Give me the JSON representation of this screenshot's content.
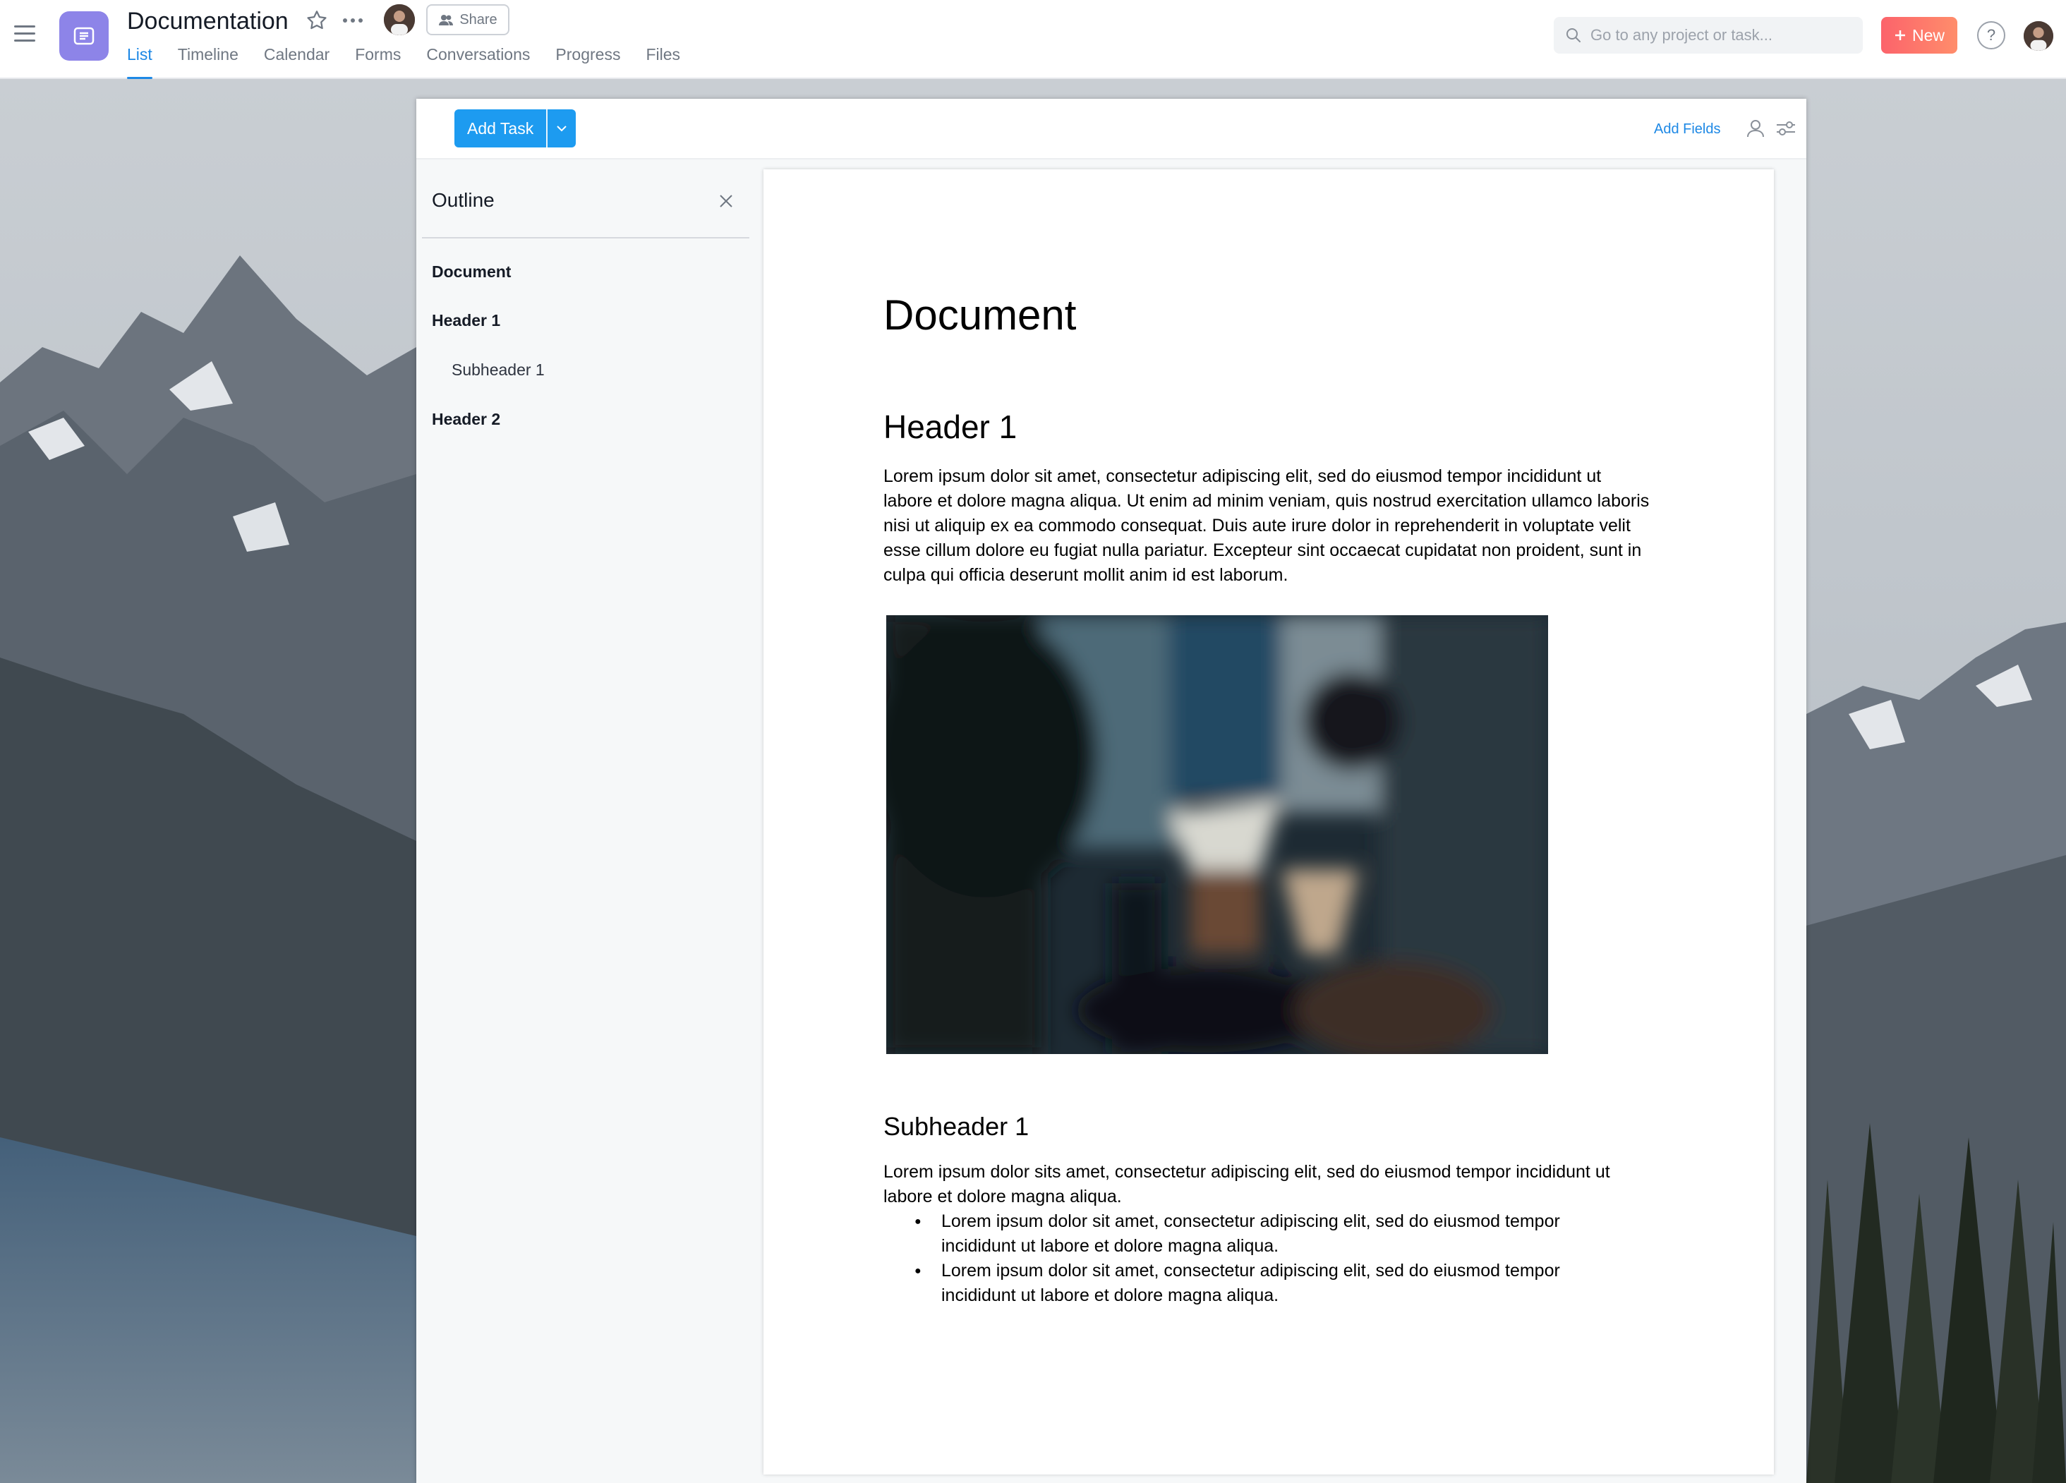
{
  "project": {
    "title": "Documentation",
    "icon": "list-icon",
    "accent": "#8d84e8"
  },
  "header": {
    "share_label": "Share",
    "tabs": [
      {
        "label": "List",
        "active": true
      },
      {
        "label": "Timeline",
        "active": false
      },
      {
        "label": "Calendar",
        "active": false
      },
      {
        "label": "Forms",
        "active": false
      },
      {
        "label": "Conversations",
        "active": false
      },
      {
        "label": "Progress",
        "active": false
      },
      {
        "label": "Files",
        "active": false
      }
    ],
    "search_placeholder": "Go to any project or task...",
    "new_label": "New",
    "help_label": "?"
  },
  "toolbar": {
    "add_task_label": "Add Task",
    "add_fields_label": "Add Fields"
  },
  "outline": {
    "title": "Outline",
    "items": [
      {
        "label": "Document"
      },
      {
        "label": "Header 1"
      },
      {
        "label": "Subheader 1"
      },
      {
        "label": "Header 2"
      }
    ]
  },
  "document": {
    "title": "Document",
    "header1": "Header 1",
    "paragraph1": "Lorem ipsum dolor sit amet, consectetur adipiscing elit, sed do eiusmod tempor incididunt ut labore et dolore magna aliqua. Ut enim ad minim veniam, quis nostrud exercitation ullamco laboris nisi ut aliquip ex ea commodo consequat. Duis aute irure dolor in reprehenderit in voluptate velit esse cillum dolore eu fugiat nulla pariatur. Excepteur sint occaecat cupidatat non proident, sunt in culpa qui officia deserunt mollit anim id est laborum.",
    "subheader1": "Subheader 1",
    "paragraph2": "Lorem ipsum dolor sits amet, consectetur adipiscing elit, sed do eiusmod tempor incididunt ut labore et dolore magna aliqua.",
    "bullets": [
      "Lorem ipsum dolor sit amet, consectetur adipiscing elit, sed do eiusmod tempor incididunt ut labore et dolore magna aliqua.",
      "Lorem ipsum dolor sit amet, consectetur adipiscing elit, sed do eiusmod tempor incididunt ut labore et dolore magna aliqua."
    ]
  },
  "colors": {
    "primary_blue": "#1d9bf0",
    "tab_active": "#1d88e5",
    "new_gradient_start": "#fc636b",
    "new_gradient_end": "#ff8d6b"
  }
}
